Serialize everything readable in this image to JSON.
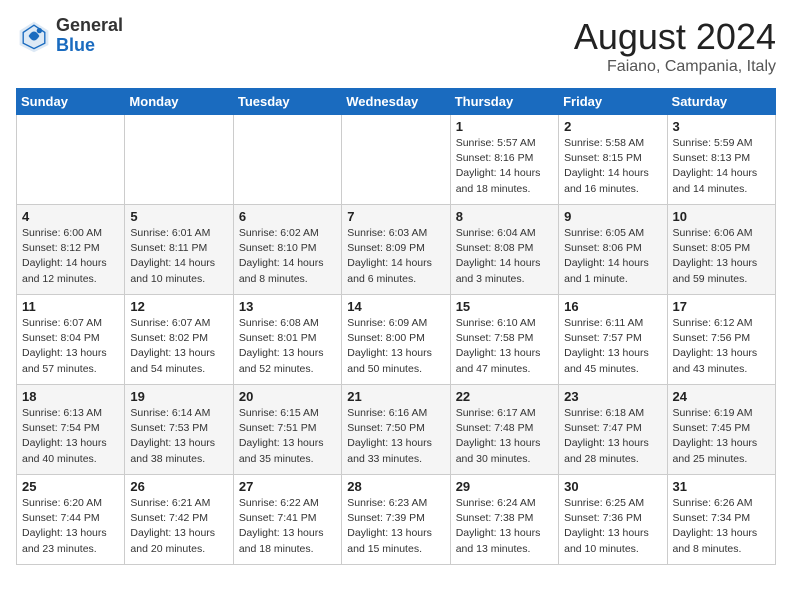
{
  "logo": {
    "general": "General",
    "blue": "Blue"
  },
  "title": "August 2024",
  "location": "Faiano, Campania, Italy",
  "days_of_week": [
    "Sunday",
    "Monday",
    "Tuesday",
    "Wednesday",
    "Thursday",
    "Friday",
    "Saturday"
  ],
  "weeks": [
    [
      {
        "day": "",
        "info": ""
      },
      {
        "day": "",
        "info": ""
      },
      {
        "day": "",
        "info": ""
      },
      {
        "day": "",
        "info": ""
      },
      {
        "day": "1",
        "info": "Sunrise: 5:57 AM\nSunset: 8:16 PM\nDaylight: 14 hours\nand 18 minutes."
      },
      {
        "day": "2",
        "info": "Sunrise: 5:58 AM\nSunset: 8:15 PM\nDaylight: 14 hours\nand 16 minutes."
      },
      {
        "day": "3",
        "info": "Sunrise: 5:59 AM\nSunset: 8:13 PM\nDaylight: 14 hours\nand 14 minutes."
      }
    ],
    [
      {
        "day": "4",
        "info": "Sunrise: 6:00 AM\nSunset: 8:12 PM\nDaylight: 14 hours\nand 12 minutes."
      },
      {
        "day": "5",
        "info": "Sunrise: 6:01 AM\nSunset: 8:11 PM\nDaylight: 14 hours\nand 10 minutes."
      },
      {
        "day": "6",
        "info": "Sunrise: 6:02 AM\nSunset: 8:10 PM\nDaylight: 14 hours\nand 8 minutes."
      },
      {
        "day": "7",
        "info": "Sunrise: 6:03 AM\nSunset: 8:09 PM\nDaylight: 14 hours\nand 6 minutes."
      },
      {
        "day": "8",
        "info": "Sunrise: 6:04 AM\nSunset: 8:08 PM\nDaylight: 14 hours\nand 3 minutes."
      },
      {
        "day": "9",
        "info": "Sunrise: 6:05 AM\nSunset: 8:06 PM\nDaylight: 14 hours\nand 1 minute."
      },
      {
        "day": "10",
        "info": "Sunrise: 6:06 AM\nSunset: 8:05 PM\nDaylight: 13 hours\nand 59 minutes."
      }
    ],
    [
      {
        "day": "11",
        "info": "Sunrise: 6:07 AM\nSunset: 8:04 PM\nDaylight: 13 hours\nand 57 minutes."
      },
      {
        "day": "12",
        "info": "Sunrise: 6:07 AM\nSunset: 8:02 PM\nDaylight: 13 hours\nand 54 minutes."
      },
      {
        "day": "13",
        "info": "Sunrise: 6:08 AM\nSunset: 8:01 PM\nDaylight: 13 hours\nand 52 minutes."
      },
      {
        "day": "14",
        "info": "Sunrise: 6:09 AM\nSunset: 8:00 PM\nDaylight: 13 hours\nand 50 minutes."
      },
      {
        "day": "15",
        "info": "Sunrise: 6:10 AM\nSunset: 7:58 PM\nDaylight: 13 hours\nand 47 minutes."
      },
      {
        "day": "16",
        "info": "Sunrise: 6:11 AM\nSunset: 7:57 PM\nDaylight: 13 hours\nand 45 minutes."
      },
      {
        "day": "17",
        "info": "Sunrise: 6:12 AM\nSunset: 7:56 PM\nDaylight: 13 hours\nand 43 minutes."
      }
    ],
    [
      {
        "day": "18",
        "info": "Sunrise: 6:13 AM\nSunset: 7:54 PM\nDaylight: 13 hours\nand 40 minutes."
      },
      {
        "day": "19",
        "info": "Sunrise: 6:14 AM\nSunset: 7:53 PM\nDaylight: 13 hours\nand 38 minutes."
      },
      {
        "day": "20",
        "info": "Sunrise: 6:15 AM\nSunset: 7:51 PM\nDaylight: 13 hours\nand 35 minutes."
      },
      {
        "day": "21",
        "info": "Sunrise: 6:16 AM\nSunset: 7:50 PM\nDaylight: 13 hours\nand 33 minutes."
      },
      {
        "day": "22",
        "info": "Sunrise: 6:17 AM\nSunset: 7:48 PM\nDaylight: 13 hours\nand 30 minutes."
      },
      {
        "day": "23",
        "info": "Sunrise: 6:18 AM\nSunset: 7:47 PM\nDaylight: 13 hours\nand 28 minutes."
      },
      {
        "day": "24",
        "info": "Sunrise: 6:19 AM\nSunset: 7:45 PM\nDaylight: 13 hours\nand 25 minutes."
      }
    ],
    [
      {
        "day": "25",
        "info": "Sunrise: 6:20 AM\nSunset: 7:44 PM\nDaylight: 13 hours\nand 23 minutes."
      },
      {
        "day": "26",
        "info": "Sunrise: 6:21 AM\nSunset: 7:42 PM\nDaylight: 13 hours\nand 20 minutes."
      },
      {
        "day": "27",
        "info": "Sunrise: 6:22 AM\nSunset: 7:41 PM\nDaylight: 13 hours\nand 18 minutes."
      },
      {
        "day": "28",
        "info": "Sunrise: 6:23 AM\nSunset: 7:39 PM\nDaylight: 13 hours\nand 15 minutes."
      },
      {
        "day": "29",
        "info": "Sunrise: 6:24 AM\nSunset: 7:38 PM\nDaylight: 13 hours\nand 13 minutes."
      },
      {
        "day": "30",
        "info": "Sunrise: 6:25 AM\nSunset: 7:36 PM\nDaylight: 13 hours\nand 10 minutes."
      },
      {
        "day": "31",
        "info": "Sunrise: 6:26 AM\nSunset: 7:34 PM\nDaylight: 13 hours\nand 8 minutes."
      }
    ]
  ]
}
